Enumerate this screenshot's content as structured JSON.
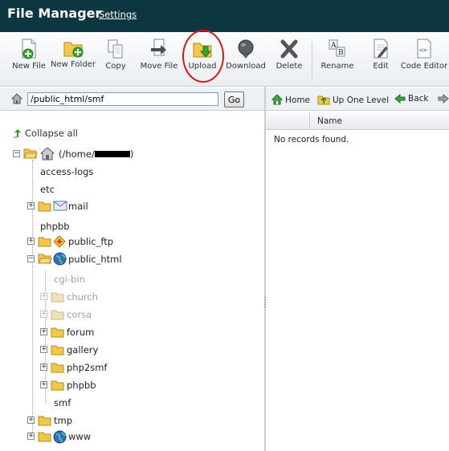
{
  "header": {
    "title": "File Manager",
    "settings_link": "Settings"
  },
  "toolbar": {
    "buttons": [
      {
        "label": "New File",
        "icon": "new-file-icon"
      },
      {
        "label": "New Folder",
        "icon": "new-folder-icon"
      },
      {
        "label": "Copy",
        "icon": "copy-icon"
      },
      {
        "label": "Move File",
        "icon": "move-file-icon"
      },
      {
        "label": "Upload",
        "icon": "upload-icon"
      },
      {
        "label": "Download",
        "icon": "download-icon"
      },
      {
        "label": "Delete",
        "icon": "delete-icon"
      },
      {
        "label": "Rename",
        "icon": "rename-icon"
      },
      {
        "label": "Edit",
        "icon": "edit-icon"
      },
      {
        "label": "Code Editor",
        "icon": "code-editor-icon"
      }
    ],
    "highlight_color": "#d21a1a"
  },
  "pathbar": {
    "path_value": "/public_html/smf",
    "go_label": "Go"
  },
  "navbar": {
    "home": "Home",
    "up": "Up One Level",
    "back": "Back"
  },
  "tree": {
    "collapse_label": "Collapse all",
    "root_label": "(/home/",
    "root_suffix": ")",
    "items": {
      "access_logs": "access-logs",
      "etc": "etc",
      "mail": "mail",
      "phpbb": "phpbb",
      "public_ftp": "public_ftp",
      "public_html": "public_html",
      "cgi_bin": "cgi-bin",
      "church": "church",
      "corsa": "corsa",
      "forum": "forum",
      "gallery": "gallery",
      "php2smf": "php2smf",
      "phpbb_sub": "phpbb",
      "smf": "smf",
      "tmp": "tmp",
      "www": "www"
    }
  },
  "file_list": {
    "column_name": "Name",
    "empty_message": "No records found."
  },
  "colors": {
    "header_bg": "#0c3640",
    "folder": "#f3c84a",
    "globe": "#2a6fd1"
  }
}
